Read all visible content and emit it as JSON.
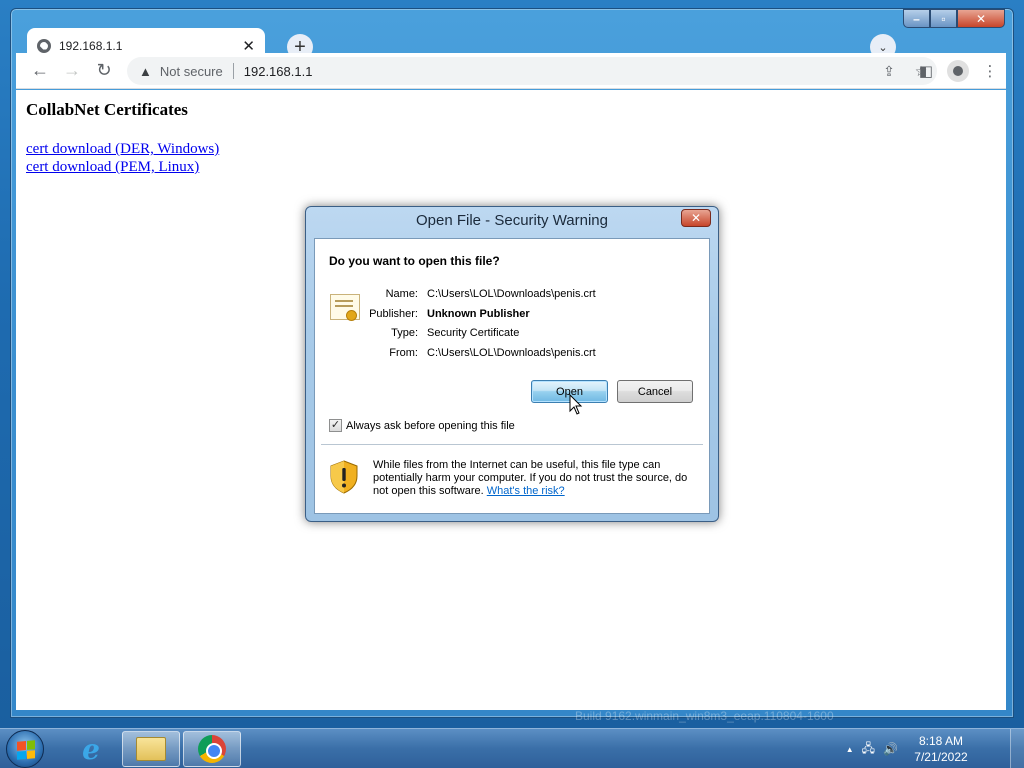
{
  "browser": {
    "tab_title": "192.168.1.1",
    "tab_close": "✕",
    "new_tab": "+",
    "tab_search": "⌄",
    "security_label": "Not secure",
    "url": "192.168.1.1",
    "window_controls": {
      "minimize": "–",
      "maximize": "▫",
      "close": "✕"
    }
  },
  "page": {
    "heading": "CollabNet Certificates",
    "links": [
      "cert download (DER, Windows)",
      "cert download (PEM, Linux)"
    ]
  },
  "dialog": {
    "title": "Open File - Security Warning",
    "question": "Do you want to open this file?",
    "fields": [
      {
        "label": "Name:",
        "value": "C:\\Users\\LOL\\Downloads\\penis.crt"
      },
      {
        "label": "Publisher:",
        "value": "Unknown Publisher"
      },
      {
        "label": "Type:",
        "value": "Security Certificate"
      },
      {
        "label": "From:",
        "value": "C:\\Users\\LOL\\Downloads\\penis.crt"
      }
    ],
    "open_label": "Open",
    "cancel_label": "Cancel",
    "checkbox_label": "Always ask before opening this file",
    "checkbox_checked": true,
    "warning_text": "While files from the Internet can be useful, this file type can potentially harm your computer. If you do not trust the source, do not open this software.",
    "warning_link": "What's the risk?"
  },
  "watermark": "Build 9162.winmain_win8m3_eeap.110804-1600",
  "taskbar": {
    "time": "8:18 AM",
    "date": "7/21/2022",
    "tray_arrow": "▲"
  },
  "colors": {
    "link": "#0000ee",
    "dialog_frame": "#a8cbe9",
    "taskbar": "#3a6fa8"
  }
}
